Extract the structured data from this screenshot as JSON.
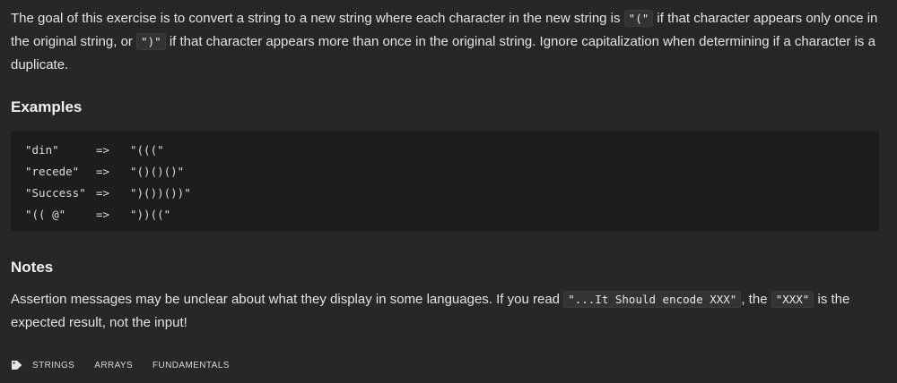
{
  "description": {
    "part1": "The goal of this exercise is to convert a string to a new string where each character in the new string is ",
    "code1": "\"(\"",
    "part2": " if that character appears only once in the original string, or ",
    "code2": "\")\"",
    "part3": " if that character appears more than once in the original string. Ignore capitalization when determining if a character is a duplicate."
  },
  "examples": {
    "heading": "Examples",
    "rows": [
      {
        "input": "\"din\"",
        "arrow": "=>",
        "output": "\"(((\""
      },
      {
        "input": "\"recede\"",
        "arrow": "=>",
        "output": "\"()()()\""
      },
      {
        "input": "\"Success\"",
        "arrow": "=>",
        "output": "\")())())\""
      },
      {
        "input": "\"(( @\"",
        "arrow": "=>",
        "output": "\"))((\""
      }
    ]
  },
  "notes": {
    "heading": "Notes",
    "part1": "Assertion messages may be unclear about what they display in some languages. If you read ",
    "code1": "\"...It Should encode XXX\"",
    "part2": ", the ",
    "code2": "\"XXX\"",
    "part3": " is the expected result, not the input!"
  },
  "tags": {
    "icon": "tag-icon",
    "items": [
      "STRINGS",
      "ARRAYS",
      "FUNDAMENTALS"
    ]
  }
}
